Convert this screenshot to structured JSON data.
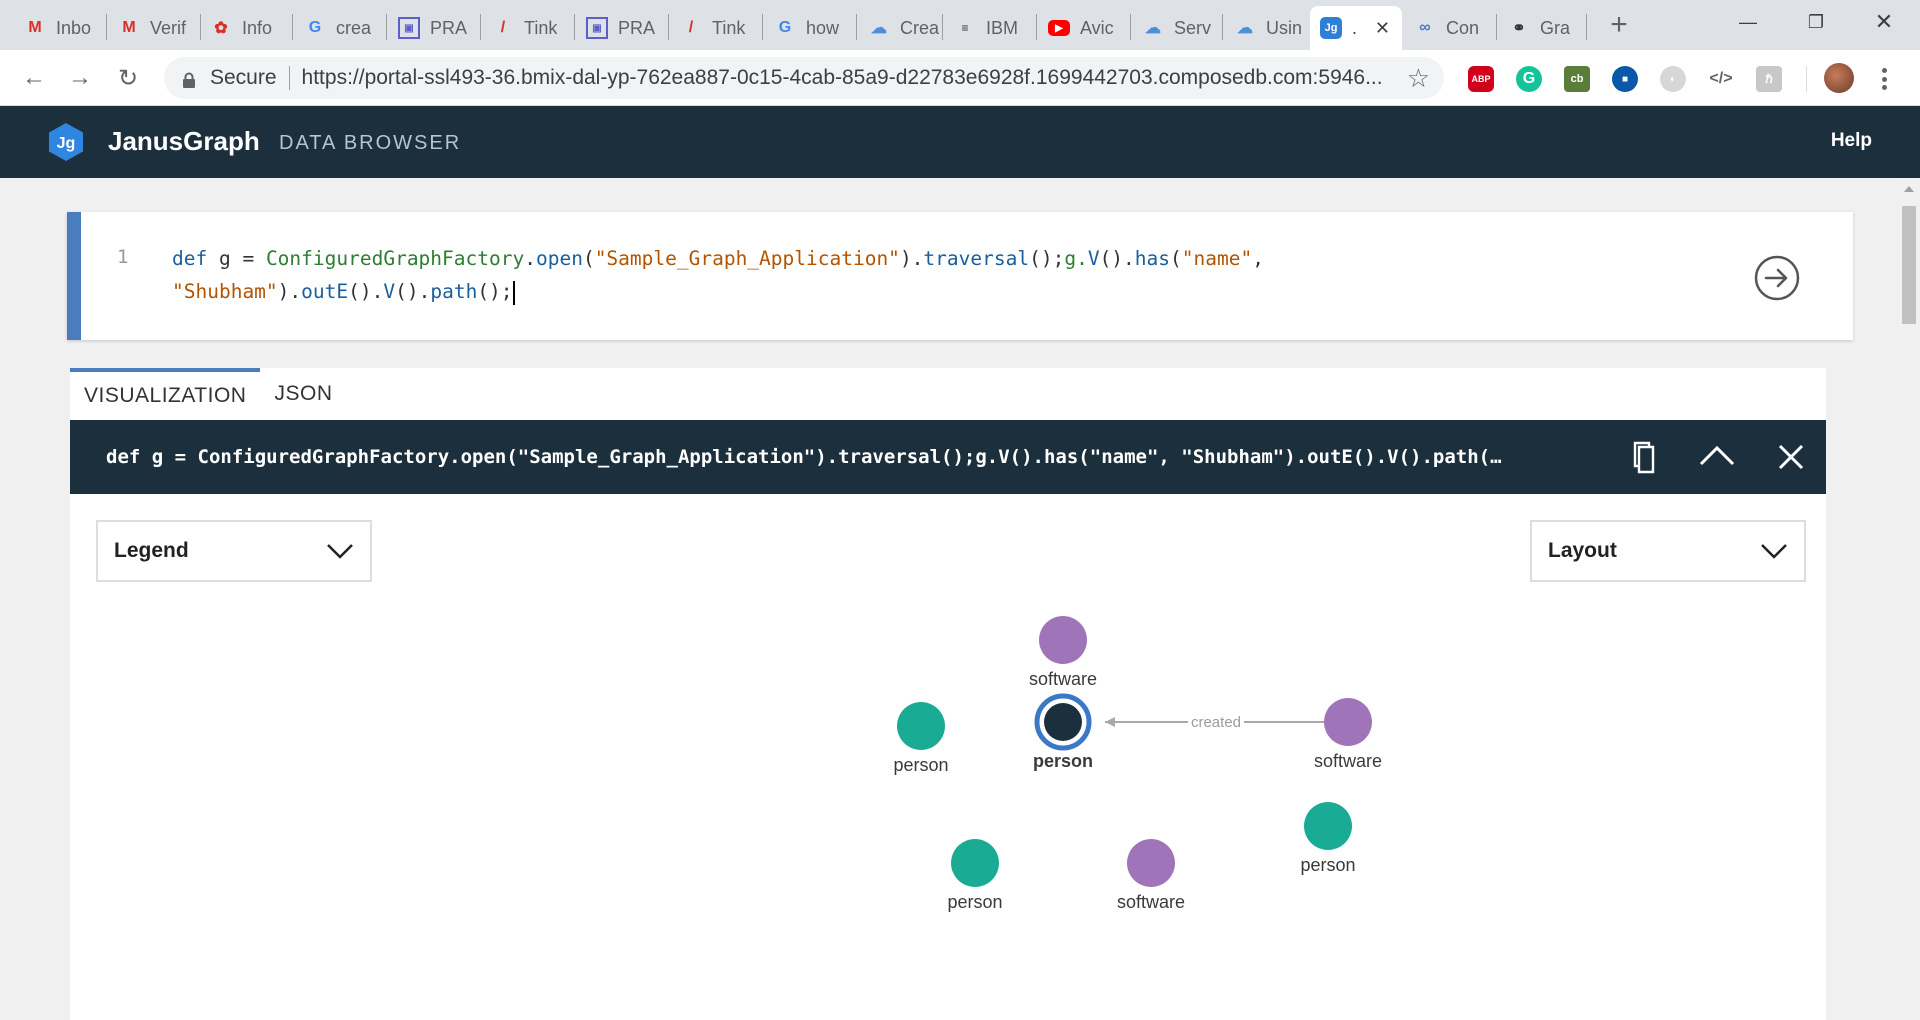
{
  "browser": {
    "tabs": [
      {
        "label": "Inbo",
        "icon": "gmail-icon"
      },
      {
        "label": "Verif",
        "icon": "gmail-icon"
      },
      {
        "label": "Info",
        "icon": "settings-wheel-icon"
      },
      {
        "label": "crea",
        "icon": "google-icon"
      },
      {
        "label": "PRA",
        "icon": "square-target-icon"
      },
      {
        "label": "Tink",
        "icon": "feather-icon"
      },
      {
        "label": "PRA",
        "icon": "square-target-icon"
      },
      {
        "label": "Tink",
        "icon": "feather-icon"
      },
      {
        "label": "how",
        "icon": "google-icon"
      },
      {
        "label": "Crea",
        "icon": "cloud-icon"
      },
      {
        "label": "IBM",
        "icon": "ibm-icon"
      },
      {
        "label": "Avic",
        "icon": "youtube-icon"
      },
      {
        "label": "Serv",
        "icon": "cloud-icon"
      },
      {
        "label": "Usin",
        "icon": "cloud-icon"
      },
      {
        "label": ".",
        "icon": "janusgraph-icon",
        "active": true
      },
      {
        "label": "Con",
        "icon": "chain-icon"
      },
      {
        "label": "Gra",
        "icon": "graph-icon"
      }
    ],
    "secure_label": "Secure",
    "url": "https://portal-ssl493-36.bmix-dal-yp-762ea887-0c15-4cab-85a9-d22783e6928f.1699442703.composedb.com:5946..."
  },
  "app": {
    "logo_text": "Jg",
    "brand": "JanusGraph",
    "subtitle": "DATA BROWSER",
    "help": "Help"
  },
  "editor": {
    "line_number": "1",
    "code_line1": {
      "def": "def",
      "g_eq": " g = ",
      "factory": "ConfiguredGraphFactory",
      "dot_open": ".",
      "open": "open",
      "paren1": "(",
      "str1": "\"Sample_Graph_Application\"",
      "paren2": ").",
      "traversal": "traversal",
      "mid": "();",
      "gv": "g.",
      "V": "V",
      "mid2": "().",
      "has": "has",
      "paren3": "(",
      "str2": "\"name\"",
      "comma": ","
    },
    "code_line2": {
      "str3": "\"Shubham\"",
      "p1": ").",
      "outE": "outE",
      "p2": "().",
      "V": "V",
      "p3": "().",
      "path": "path",
      "p4": "();"
    }
  },
  "panel": {
    "tabs": [
      "VISUALIZATION",
      "JSON"
    ],
    "query": "def g = ConfiguredGraphFactory.open(\"Sample_Graph_Application\").traversal();g.V().has(\"name\", \"Shubham\").outE().V().path(…",
    "legend_label": "Legend",
    "layout_label": "Layout"
  },
  "graph": {
    "colors": {
      "person": "#1aab94",
      "software": "#a074b9",
      "selected": "#1c2f3c",
      "selected_ring": "#3b78c6"
    },
    "nodes": [
      {
        "label": "software",
        "type": "software"
      },
      {
        "label": "person",
        "type": "person"
      },
      {
        "label": "person",
        "type": "person",
        "selected": true
      },
      {
        "label": "software",
        "type": "software"
      },
      {
        "label": "person",
        "type": "person"
      },
      {
        "label": "person",
        "type": "person"
      },
      {
        "label": "software",
        "type": "software"
      }
    ],
    "edge_label": "created"
  }
}
